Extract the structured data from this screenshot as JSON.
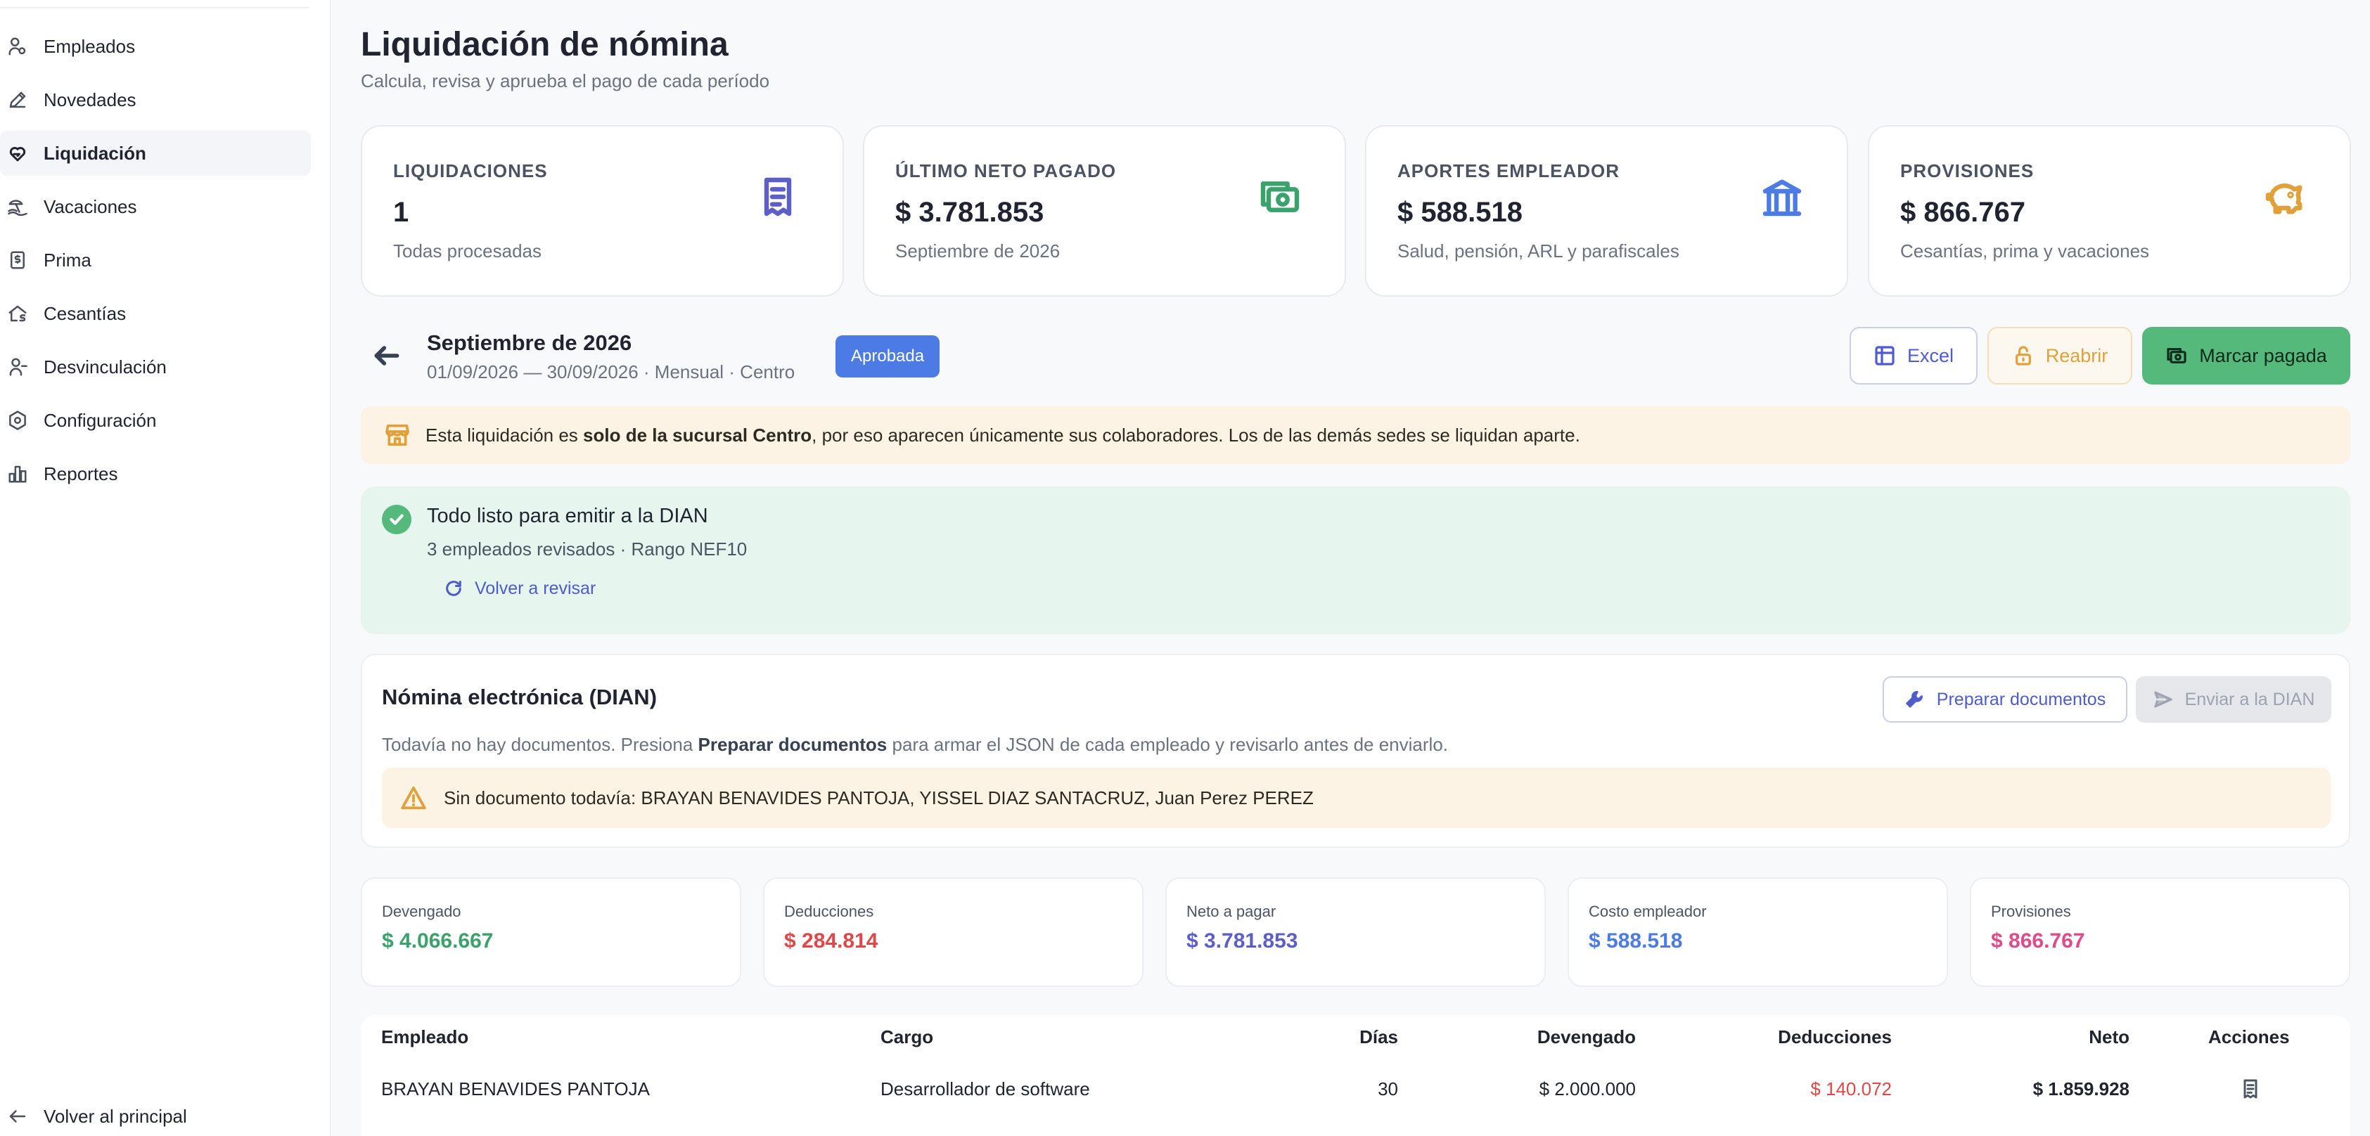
{
  "sidebar": {
    "items": [
      {
        "label": "Empleados",
        "icon": "user-icon"
      },
      {
        "label": "Novedades",
        "icon": "pencil-icon"
      },
      {
        "label": "Liquidación",
        "icon": "heart-hand-icon",
        "active": true
      },
      {
        "label": "Vacaciones",
        "icon": "beach-icon"
      },
      {
        "label": "Prima",
        "icon": "dollar-file-icon"
      },
      {
        "label": "Cesantías",
        "icon": "house-dollar-icon"
      },
      {
        "label": "Desvinculación",
        "icon": "user-minus-icon"
      },
      {
        "label": "Configuración",
        "icon": "gear-icon"
      },
      {
        "label": "Reportes",
        "icon": "bar-chart-icon"
      }
    ],
    "back_label": "Volver al principal"
  },
  "header": {
    "title": "Liquidación de nómina",
    "subtitle": "Calcula, revisa y aprueba el pago de cada período"
  },
  "stats": [
    {
      "label": "LIQUIDACIONES",
      "value": "1",
      "desc": "Todas procesadas",
      "icon": "receipt-icon",
      "color": "#5b5fc7"
    },
    {
      "label": "ÚLTIMO NETO PAGADO",
      "value": "$ 3.781.853",
      "desc": "Septiembre de 2026",
      "icon": "cash-icon",
      "color": "#3aa26a"
    },
    {
      "label": "APORTES EMPLEADOR",
      "value": "$ 588.518",
      "desc": "Salud, pensión, ARL y parafiscales",
      "icon": "bank-icon",
      "color": "#4d7be6"
    },
    {
      "label": "PROVISIONES",
      "value": "$ 866.767",
      "desc": "Cesantías, prima y vacaciones",
      "icon": "piggy-bank-icon",
      "color": "#e0a13a"
    }
  ],
  "period": {
    "title": "Septiembre de 2026",
    "subtitle": "01/09/2026 — 30/09/2026 · Mensual · Centro",
    "status": "Aprobada"
  },
  "actions": {
    "excel": "Excel",
    "reabrir": "Reabrir",
    "pagada": "Marcar pagada"
  },
  "notice": {
    "before": "Esta liquidación es ",
    "bold": "solo de la sucursal Centro",
    "after": ", por eso aparecen únicamente sus colaboradores. Los de las demás sedes se liquidan aparte."
  },
  "ready": {
    "title": "Todo listo para emitir a la DIAN",
    "detail": "3 empleados revisados · Rango NEF10",
    "recheck": "Volver a revisar"
  },
  "dian": {
    "title": "Nómina electrónica (DIAN)",
    "prepare": "Preparar documentos",
    "send": "Enviar a la DIAN",
    "desc_before": "Todavía no hay documentos. Presiona ",
    "desc_bold": "Preparar documentos",
    "desc_after": " para armar el JSON de cada empleado y revisarlo antes de enviarlo.",
    "warning": "Sin documento todavía: BRAYAN BENAVIDES PANTOJA, YISSEL DIAZ SANTACRUZ, Juan Perez PEREZ"
  },
  "summary": [
    {
      "label": "Devengado",
      "value": "$ 4.066.667",
      "color": "#3aa26a"
    },
    {
      "label": "Deducciones",
      "value": "$ 284.814",
      "color": "#e04848"
    },
    {
      "label": "Neto a pagar",
      "value": "$ 3.781.853",
      "color": "#5b5fc7"
    },
    {
      "label": "Costo empleador",
      "value": "$ 588.518",
      "color": "#4d7be6"
    },
    {
      "label": "Provisiones",
      "value": "$ 866.767",
      "color": "#e04a8a"
    }
  ],
  "table": {
    "headers": [
      "Empleado",
      "Cargo",
      "Días",
      "Devengado",
      "Deducciones",
      "Neto",
      "Acciones"
    ],
    "rows": [
      {
        "empleado": "BRAYAN BENAVIDES PANTOJA",
        "cargo": "Desarrollador de software",
        "dias": "30",
        "devengado": "$ 2.000.000",
        "deducciones": "$ 140.072",
        "neto": "$ 1.859.928"
      }
    ]
  }
}
